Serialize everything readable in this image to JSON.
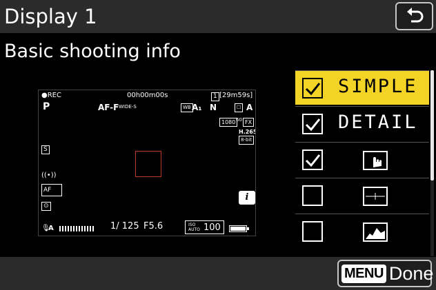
{
  "header": {
    "title": "Display 1",
    "back_icon": "return-arrow-icon"
  },
  "subtitle": "Basic shooting info",
  "preview": {
    "rec": "●REC",
    "timecode": "00h00m00s",
    "remaining": "[29m59s]",
    "card_icon": "1",
    "mode": "P",
    "focus_mode": "AF-F",
    "af_area": "WIDE-S",
    "wb": "A₁",
    "picture_control": "N",
    "active_d": "A",
    "frame_size": "1080",
    "fps": "60",
    "image_area": "FX",
    "codec": "H.265",
    "bit_depth": "8-bit",
    "shutter": "1/ 125",
    "aperture": "F5.6",
    "iso_label": "ISO AUTO",
    "iso": "100",
    "mic": "A",
    "af_subject": "AF",
    "info_button": "i",
    "battery_level": 1.0
  },
  "list": {
    "items": [
      {
        "label": "SIMPLE",
        "checked": true,
        "selected": true,
        "icon": ""
      },
      {
        "label": "DETAIL",
        "checked": true,
        "selected": false,
        "icon": ""
      },
      {
        "label": "",
        "checked": true,
        "selected": false,
        "icon": "touch-hand-icon"
      },
      {
        "label": "",
        "checked": false,
        "selected": false,
        "icon": "virtual-horizon-icon"
      },
      {
        "label": "",
        "checked": false,
        "selected": false,
        "icon": "histogram-icon"
      }
    ]
  },
  "footer": {
    "menu_key": "MENU",
    "done_label": "Done"
  },
  "colors": {
    "highlight": "#f4d327",
    "bar": "#2b2b2b"
  }
}
